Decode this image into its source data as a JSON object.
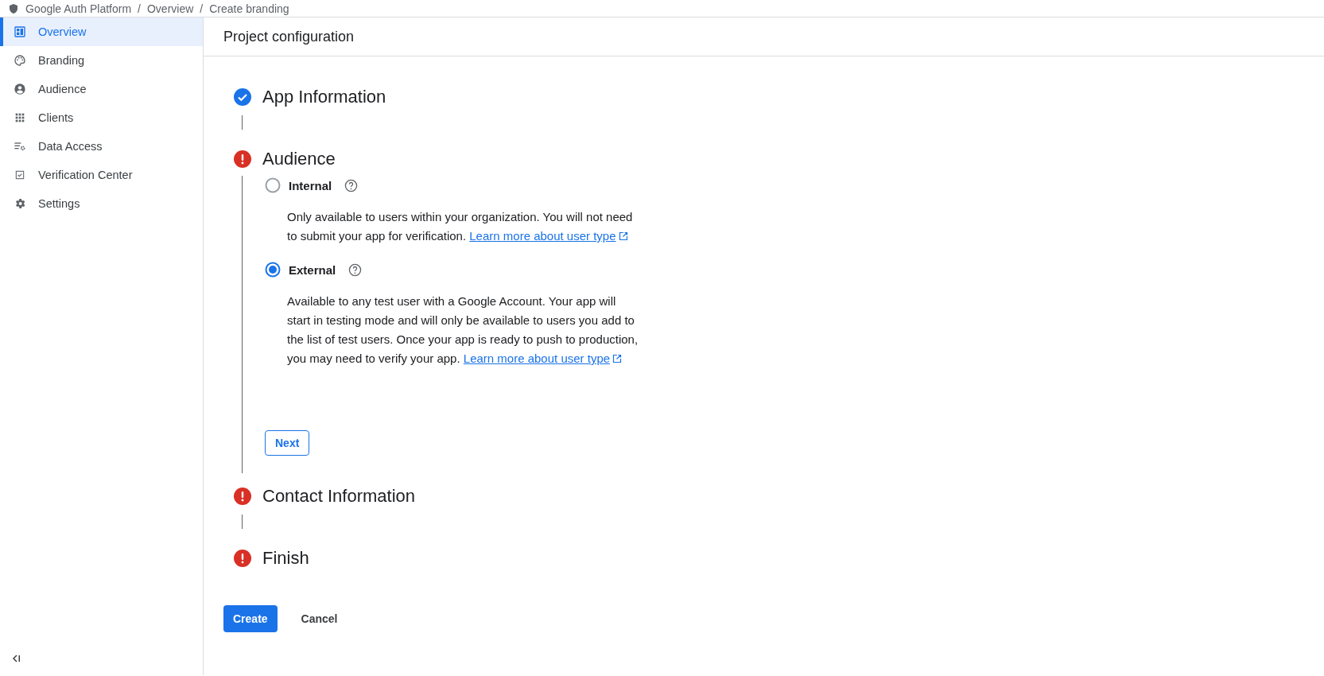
{
  "breadcrumb": {
    "separator": "/",
    "items": [
      "Google Auth Platform",
      "Overview",
      "Create branding"
    ]
  },
  "sidebar": {
    "items": [
      {
        "label": "Overview",
        "selected": true
      },
      {
        "label": "Branding",
        "selected": false
      },
      {
        "label": "Audience",
        "selected": false
      },
      {
        "label": "Clients",
        "selected": false
      },
      {
        "label": "Data Access",
        "selected": false
      },
      {
        "label": "Verification Center",
        "selected": false
      },
      {
        "label": "Settings",
        "selected": false
      }
    ]
  },
  "page_title": "Project configuration",
  "steps": [
    {
      "title": "App Information",
      "complete": true
    },
    {
      "title": "Audience",
      "complete": false,
      "options": [
        {
          "label": "Internal",
          "selected": false,
          "description": "Only available to users within your organization. You will not need to submit your app for verification.",
          "link": "Learn more about user type"
        },
        {
          "label": "External",
          "selected": true,
          "description": "Available to any test user with a Google Account. Your app will start in testing mode and will only be available to users you add to the list of test users. Once your app is ready to push to production, you may need to verify your app.",
          "link": "Learn more about user type"
        }
      ],
      "next_button": "Next"
    },
    {
      "title": "Contact Information",
      "complete": false
    },
    {
      "title": "Finish",
      "complete": false
    }
  ],
  "actions": {
    "create": "Create",
    "cancel": "Cancel"
  }
}
